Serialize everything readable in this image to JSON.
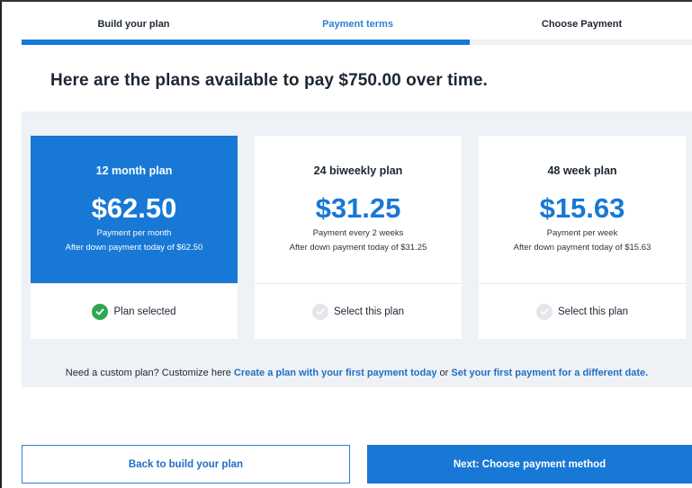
{
  "stepper": {
    "steps": [
      {
        "label": "Build your plan",
        "state": "complete"
      },
      {
        "label": "Payment terms",
        "state": "active"
      },
      {
        "label": "Choose Payment",
        "state": "upcoming"
      }
    ]
  },
  "headline": "Here are the plans available to pay $750.00 over time.",
  "plans": [
    {
      "title": "12 month plan",
      "price": "$62.50",
      "frequency": "Payment per month",
      "down_payment": "After down payment today of $62.50",
      "action": "Plan selected",
      "selected": true
    },
    {
      "title": "24 biweekly plan",
      "price": "$31.25",
      "frequency": "Payment every 2 weeks",
      "down_payment": "After down payment today of $31.25",
      "action": "Select this plan",
      "selected": false
    },
    {
      "title": "48 week plan",
      "price": "$15.63",
      "frequency": "Payment per week",
      "down_payment": "After down payment today of $15.63",
      "action": "Select this plan",
      "selected": false
    }
  ],
  "custom": {
    "prefix": "Need a custom plan? Customize here",
    "link1": "Create a plan with your first payment today",
    "joiner": "or",
    "link2": "Set your first payment for a different date."
  },
  "buttons": {
    "back": "Back to build your plan",
    "next": "Next: Choose payment method"
  },
  "colors": {
    "accent": "#1778d6",
    "check_selected": "#2fa84f",
    "panel_bg": "#eef2f6"
  },
  "icons": {
    "selected": "check-circle-icon",
    "unselected": "check-circle-outline-icon"
  }
}
